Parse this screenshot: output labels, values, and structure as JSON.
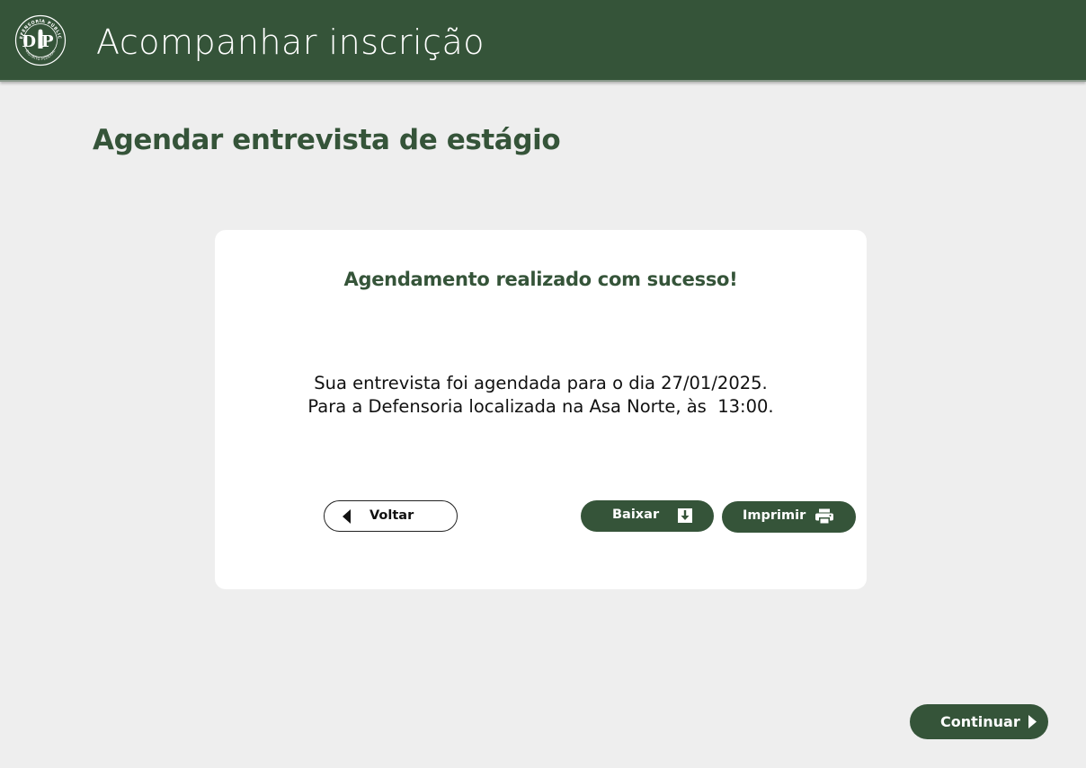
{
  "header": {
    "title": "Acompanhar inscrição",
    "logo": {
      "initials": "DP",
      "ring_text_top": "DEFENSORIA PÚBLICA",
      "ring_text_bottom": "DISTRITO FEDERAL"
    }
  },
  "page": {
    "title": "Agendar entrevista de estágio"
  },
  "card": {
    "title": "Agendamento realizado com sucesso!",
    "message_line1": "Sua entrevista foi agendada para o dia 27/01/2025.",
    "message_line2": "Para a Defensoria localizada na Asa Norte, às  13:00."
  },
  "buttons": {
    "back": {
      "label": "Voltar",
      "icon": "caret-left-icon"
    },
    "download": {
      "label": "Baixar",
      "icon": "download-icon"
    },
    "print": {
      "label": "Imprimir",
      "icon": "printer-icon"
    },
    "continue": {
      "label": "Continuar",
      "icon": "caret-right-icon"
    }
  },
  "colors": {
    "brand_green": "#355439",
    "background": "#eeeeee",
    "card": "#ffffff"
  }
}
